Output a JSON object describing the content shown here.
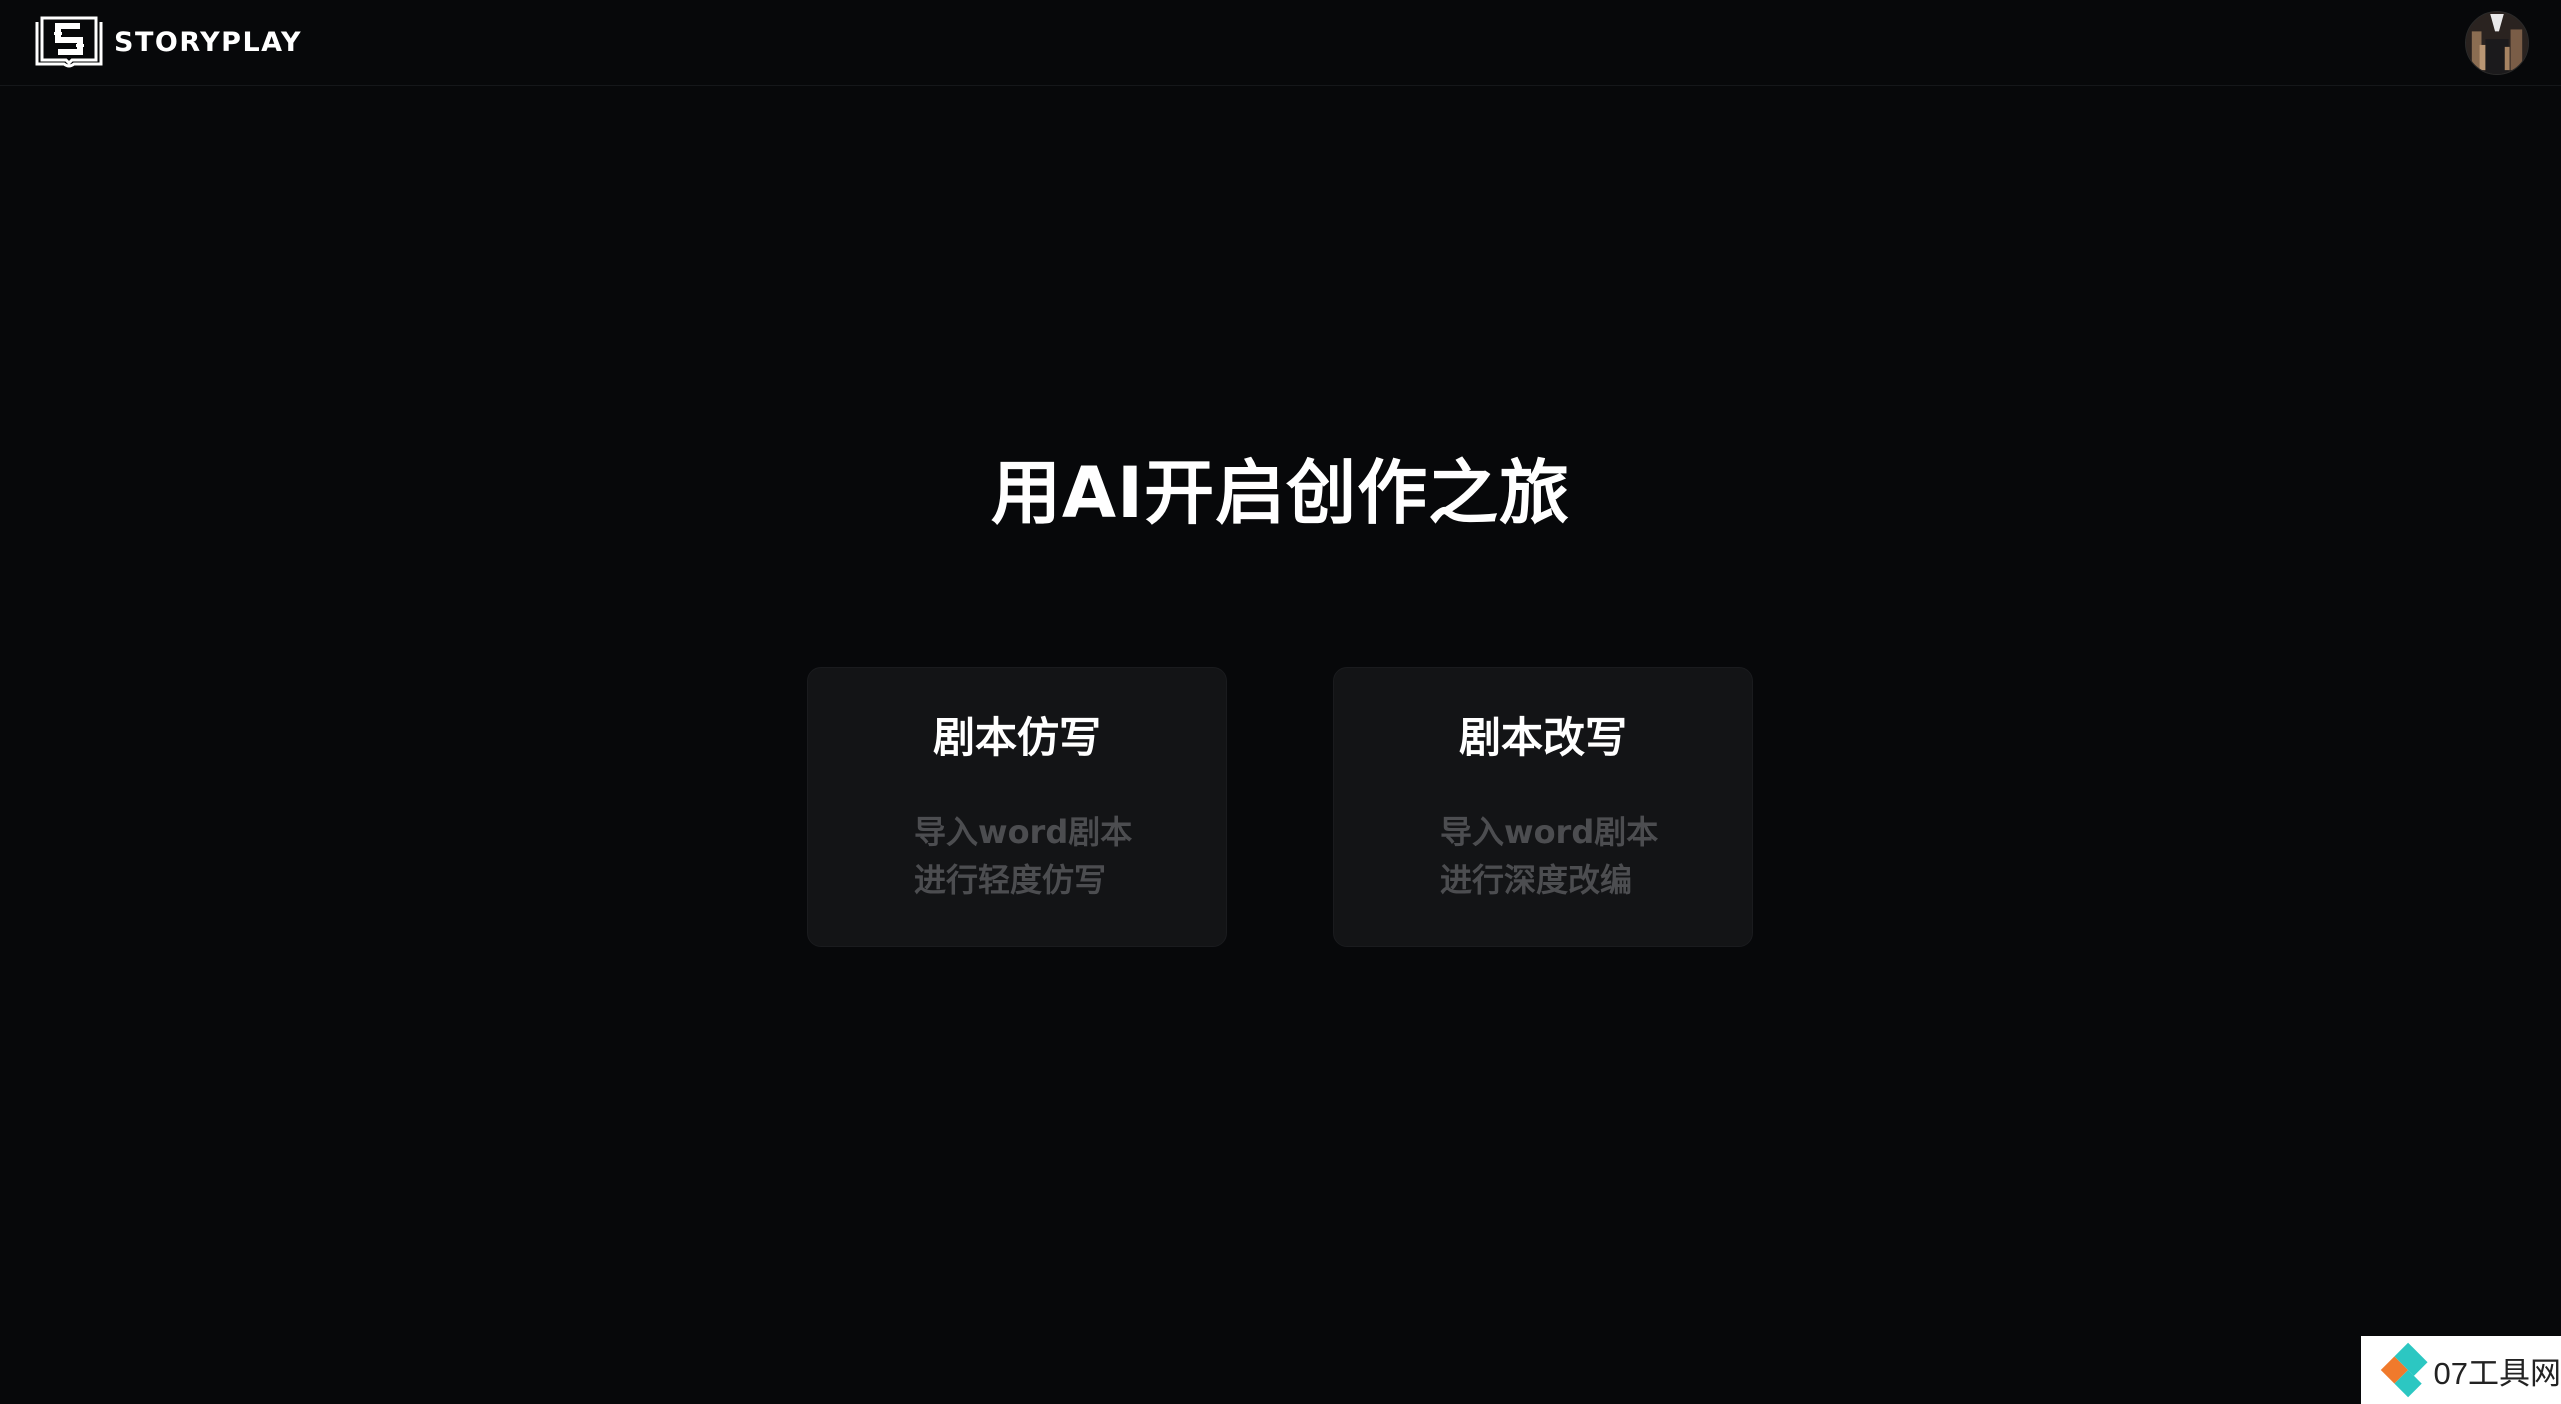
{
  "header": {
    "brand_name": "STORYPLAY",
    "logo_icon": "book-s-logo-icon",
    "avatar_icon": "user-avatar-icon"
  },
  "main": {
    "title": "用AI开启创作之旅",
    "cards": [
      {
        "title": "剧本仿写",
        "desc_line1": "导入word剧本",
        "desc_line2": "进行轻度仿写"
      },
      {
        "title": "剧本改写",
        "desc_line1": "导入word剧本",
        "desc_line2": "进行深度改编"
      }
    ]
  },
  "watermark": {
    "text": "07工具网",
    "icon": "diamond-logo-icon"
  },
  "colors": {
    "background": "#07080a",
    "card_background": "#131416",
    "title_text": "#ffffff",
    "muted_text": "#4c4d50",
    "watermark_orange": "#f07a2c",
    "watermark_teal": "#2cc7c2"
  }
}
